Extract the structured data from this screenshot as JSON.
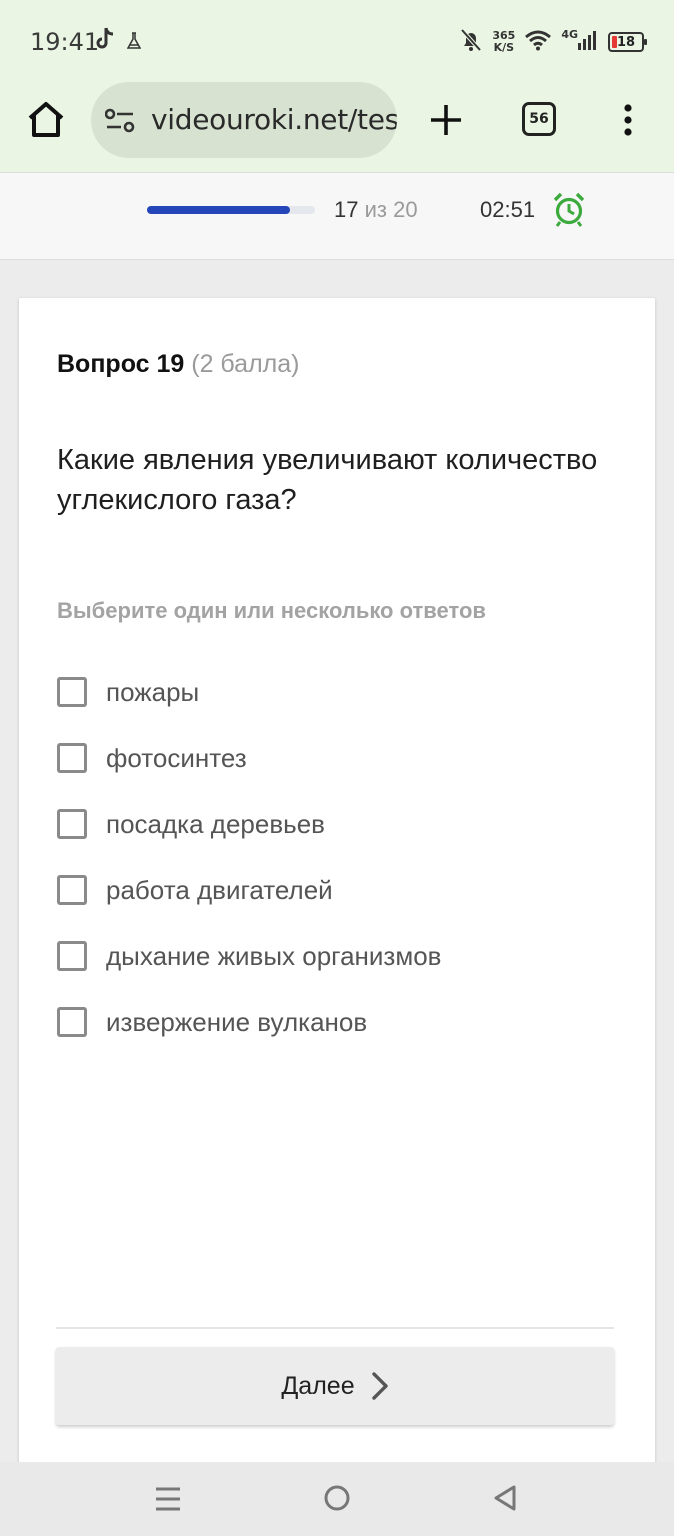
{
  "status_bar": {
    "time": "19:41",
    "left_icons": [
      "tiktok-icon",
      "flask-icon"
    ],
    "right_icons": [
      "bell-off-icon",
      "wifi-icon",
      "signal-icon"
    ],
    "net_speed_value": "365",
    "net_speed_unit": "K/S",
    "network_type": "4G",
    "battery_level": "18",
    "battery_color": "#e53935"
  },
  "browser": {
    "url": "videouroki.net/tes",
    "tab_count": "56",
    "icons": [
      "home-icon",
      "site-settings-icon",
      "plus-icon",
      "tabs-icon",
      "more-vert-icon"
    ]
  },
  "test_header": {
    "progress_current": "17",
    "progress_separator": "из",
    "progress_total": "20",
    "progress_fraction": 0.85,
    "progress_color": "#2446b8",
    "timer": "02:51",
    "timer_icon": "alarm-clock-icon",
    "timer_icon_color": "#3daa3d"
  },
  "question": {
    "label": "Вопрос 19",
    "points": "(2 балла)",
    "text": "Какие явления увеличивают количество углекислого газа?",
    "hint": "Выберите один или несколько ответов",
    "options": [
      {
        "label": "пожары",
        "checked": false
      },
      {
        "label": "фотосинтез",
        "checked": false
      },
      {
        "label": "посадка деревьев",
        "checked": false
      },
      {
        "label": "работа двигателей",
        "checked": false
      },
      {
        "label": "дыхание живых организмов",
        "checked": false
      },
      {
        "label": "извержение вулканов",
        "checked": false
      }
    ],
    "next_label": "Далее",
    "next_icon": "chevron-right-icon"
  },
  "nav_bar": {
    "icons": [
      "recents-icon",
      "home-circle-icon",
      "back-icon"
    ]
  }
}
